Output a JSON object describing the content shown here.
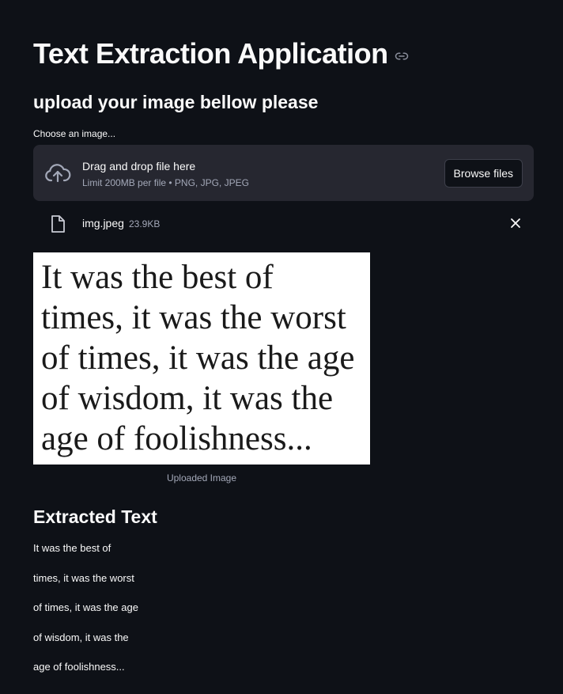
{
  "header": {
    "title": "Text Extraction Application",
    "subtitle": "upload your image bellow please"
  },
  "uploader": {
    "label": "Choose an image...",
    "drop_text": "Drag and drop file here",
    "limit_text": "Limit 200MB per file • PNG, JPG, JPEG",
    "browse_label": "Browse files",
    "file": {
      "name": "img.jpeg",
      "size": "23.9KB"
    }
  },
  "image": {
    "lines": [
      "It was the best of",
      "times, it was the worst",
      "of times, it was the age",
      "of wisdom, it was the",
      "age of foolishness..."
    ],
    "caption": "Uploaded Image"
  },
  "extracted": {
    "heading": "Extracted Text",
    "lines": [
      "It was the best of",
      "times, it was the worst",
      "of times, it was the age",
      "of wisdom, it was the",
      "age of foolishness..."
    ]
  },
  "colors": {
    "background": "#0e1117",
    "panel": "#262730",
    "text": "#fafafa",
    "muted": "#a3a8b8"
  },
  "icons": {
    "anchor": "link-icon",
    "upload": "cloud-upload-icon",
    "file": "file-icon",
    "remove": "close-icon"
  }
}
